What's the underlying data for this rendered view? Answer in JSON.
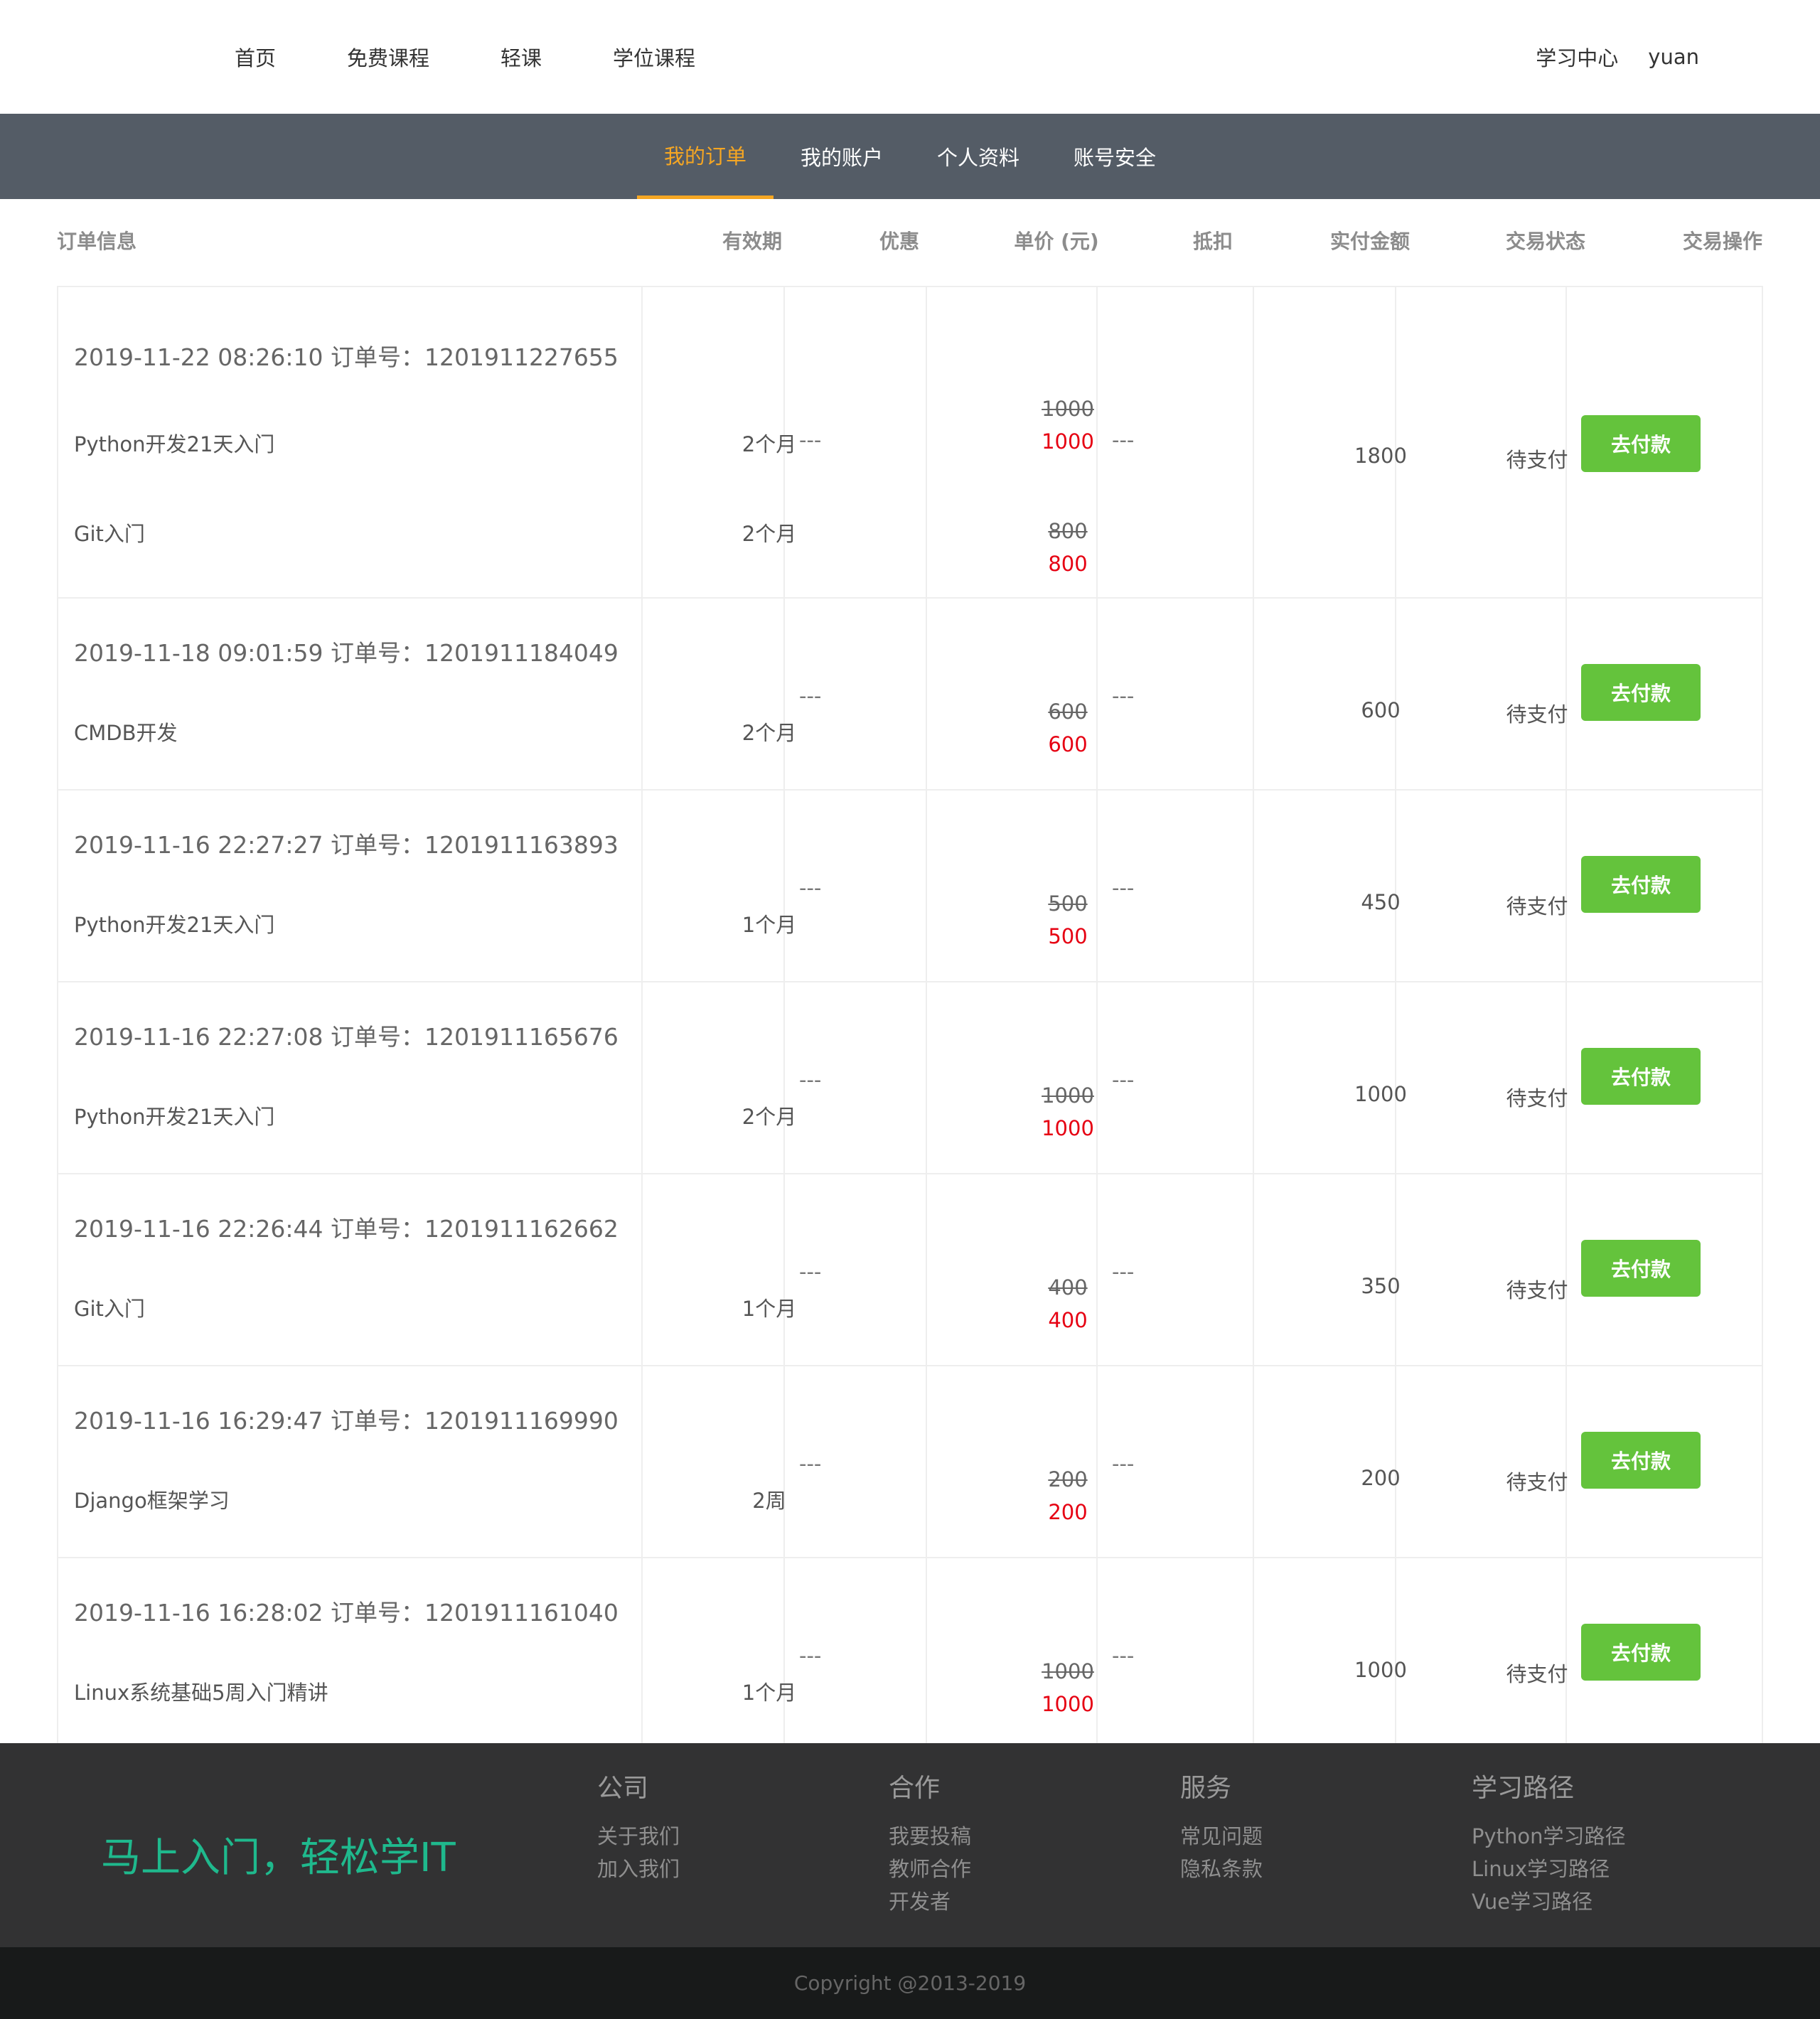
{
  "header": {
    "nav_left": [
      "首页",
      "免费课程",
      "轻课",
      "学位课程"
    ],
    "learning_center": "学习中心",
    "username": "yuan"
  },
  "subnav": {
    "tabs": [
      "我的订单",
      "我的账户",
      "个人资料",
      "账号安全"
    ],
    "active_tab": "我的订单"
  },
  "table": {
    "headers": {
      "info": "订单信息",
      "validity": "有效期",
      "discount": "优惠",
      "unit_price": "单价 (元)",
      "deduction": "抵扣",
      "paid_amount": "实付金额",
      "status": "交易状态",
      "action": "交易操作"
    },
    "orders": [
      {
        "meta": "2019-11-22 08:26:10 订单号：1201911227655",
        "discount": "---",
        "deduction": "---",
        "total": "1800",
        "status": "待支付",
        "action": "去付款",
        "items": [
          {
            "name": "Python开发21天入门",
            "validity": "2个月",
            "old_price": "1000",
            "price": "1000"
          },
          {
            "name": "Git入门",
            "validity": "2个月",
            "old_price": "800",
            "price": "800"
          }
        ]
      },
      {
        "meta": "2019-11-18 09:01:59 订单号：1201911184049",
        "discount": "---",
        "deduction": "---",
        "total": "600",
        "status": "待支付",
        "action": "去付款",
        "items": [
          {
            "name": "CMDB开发",
            "validity": "2个月",
            "old_price": "600",
            "price": "600"
          }
        ]
      },
      {
        "meta": "2019-11-16 22:27:27 订单号：1201911163893",
        "discount": "---",
        "deduction": "---",
        "total": "450",
        "status": "待支付",
        "action": "去付款",
        "items": [
          {
            "name": "Python开发21天入门",
            "validity": "1个月",
            "old_price": "500",
            "price": "500"
          }
        ]
      },
      {
        "meta": "2019-11-16 22:27:08 订单号：1201911165676",
        "discount": "---",
        "deduction": "---",
        "total": "1000",
        "status": "待支付",
        "action": "去付款",
        "items": [
          {
            "name": "Python开发21天入门",
            "validity": "2个月",
            "old_price": "1000",
            "price": "1000"
          }
        ]
      },
      {
        "meta": "2019-11-16 22:26:44 订单号：1201911162662",
        "discount": "---",
        "deduction": "---",
        "total": "350",
        "status": "待支付",
        "action": "去付款",
        "items": [
          {
            "name": "Git入门",
            "validity": "1个月",
            "old_price": "400",
            "price": "400"
          }
        ]
      },
      {
        "meta": "2019-11-16 16:29:47 订单号：1201911169990",
        "discount": "---",
        "deduction": "---",
        "total": "200",
        "status": "待支付",
        "action": "去付款",
        "items": [
          {
            "name": "Django框架学习",
            "validity": "2周",
            "old_price": "200",
            "price": "200"
          }
        ]
      },
      {
        "meta": "2019-11-16 16:28:02 订单号：1201911161040",
        "discount": "---",
        "deduction": "---",
        "total": "1000",
        "status": "待支付",
        "action": "去付款",
        "items": [
          {
            "name": "Linux系统基础5周入门精讲",
            "validity": "1个月",
            "old_price": "1000",
            "price": "1000"
          }
        ]
      }
    ]
  },
  "footer": {
    "slogan": "马上入门，轻松学IT",
    "columns": [
      {
        "title": "公司",
        "links": [
          "关于我们",
          "加入我们"
        ]
      },
      {
        "title": "合作",
        "links": [
          "我要投稿",
          "教师合作",
          "开发者"
        ]
      },
      {
        "title": "服务",
        "links": [
          "常见问题",
          "隐私条款"
        ]
      },
      {
        "title": "学习路径",
        "links": [
          "Python学习路径",
          "Linux学习路径",
          "Vue学习路径"
        ]
      }
    ],
    "copyright": "Copyright @2013-2019"
  }
}
